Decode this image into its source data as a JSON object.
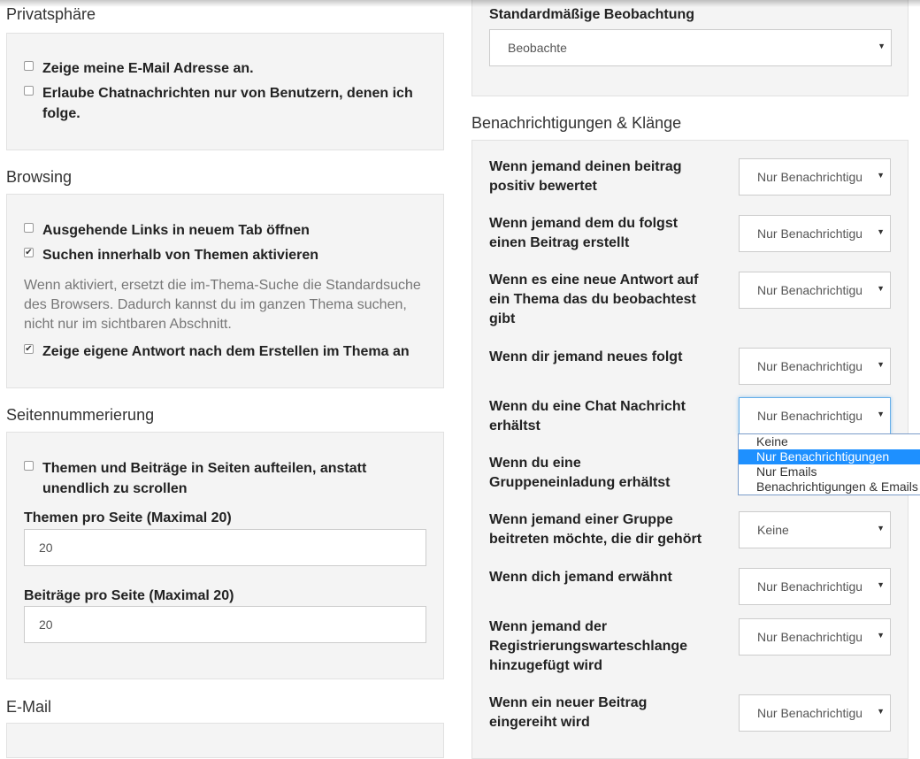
{
  "privacy": {
    "title": "Privatsphäre",
    "show_email": {
      "label": "Zeige meine E-Mail Adresse an.",
      "checked": false
    },
    "chat_followed_only": {
      "label": "Erlaube Chatnachrichten nur von Benutzern, denen ich folge.",
      "checked": false
    }
  },
  "browsing": {
    "title": "Browsing",
    "new_tab": {
      "label": "Ausgehende Links in neuem Tab öffnen",
      "checked": false
    },
    "topic_search": {
      "label": "Suchen innerhalb von Themen aktivieren",
      "checked": true
    },
    "topic_search_help": "Wenn aktiviert, ersetzt die im-Thema-Suche die Standardsuche des Browsers. Dadurch kannst du im ganzen Thema suchen, nicht nur im sichtbaren Abschnitt.",
    "show_own_reply": {
      "label": "Zeige eigene Antwort nach dem Erstellen im Thema an",
      "checked": true
    }
  },
  "pagination": {
    "title": "Seitennummerierung",
    "paginate": {
      "label": "Themen und Beiträge in Seiten aufteilen, anstatt unendlich zu scrollen",
      "checked": false
    },
    "topics_label": "Themen pro Seite (Maximal 20)",
    "topics_value": "20",
    "posts_label": "Beiträge pro Seite (Maximal 20)",
    "posts_value": "20"
  },
  "email": {
    "title": "E-Mail"
  },
  "watching": {
    "label": "Standardmäßige Beobachtung",
    "value": "Beobachte"
  },
  "notifications": {
    "title": "Benachrichtigungen & Klänge",
    "rows": [
      {
        "label": "Wenn jemand deinen beitrag positiv bewertet",
        "value": "Nur Benachrichtigungen"
      },
      {
        "label": "Wenn jemand dem du folgst einen Beitrag erstellt",
        "value": "Nur Benachrichtigungen"
      },
      {
        "label": "Wenn es eine neue Antwort auf ein Thema das du beobachtest gibt",
        "value": "Nur Benachrichtigungen"
      },
      {
        "label": "Wenn dir jemand neues folgt",
        "value": "Nur Benachrichtigungen"
      },
      {
        "label": "Wenn du eine Chat Nachricht erhältst",
        "value": "Nur Benachrichtigungen"
      },
      {
        "label": "Wenn du eine Gruppeneinladung erhältst",
        "value": ""
      },
      {
        "label": "Wenn jemand einer Gruppe beitreten möchte, die dir gehört",
        "value": "Keine"
      },
      {
        "label": "Wenn dich jemand erwähnt",
        "value": "Nur Benachrichtigungen"
      },
      {
        "label": "Wenn jemand der Registrierungswarteschlange hinzugefügt wird",
        "value": "Nur Benachrichtigungen"
      },
      {
        "label": "Wenn ein neuer Beitrag eingereiht wird",
        "value": "Nur Benachrichtigungen"
      }
    ],
    "dropdown_options": [
      "Keine",
      "Nur Benachrichtigungen",
      "Nur Emails",
      "Benachrichtigungen & Emails"
    ],
    "dropdown_selected": "Nur Benachrichtigungen"
  },
  "icons": {
    "checked_glyph": "✔",
    "arrow_glyph": "▼"
  }
}
